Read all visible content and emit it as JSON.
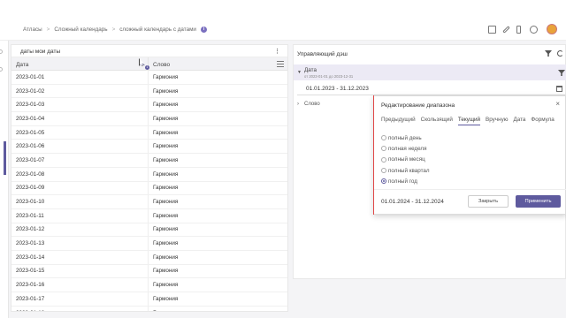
{
  "breadcrumb": [
    "Атласы",
    "Сложный календарь",
    "сложный календарь с датами"
  ],
  "breadcrumb_separator": ">",
  "info_icon": "info-icon",
  "table_panel": {
    "title": "даты мои даты",
    "menu_icon": "⋮",
    "columns": [
      "Дата",
      "Слово"
    ],
    "sort_badge": "1",
    "rows": [
      {
        "date": "2023-01-01",
        "word": "Гармония"
      },
      {
        "date": "2023-01-02",
        "word": "Гармония"
      },
      {
        "date": "2023-01-03",
        "word": "Гармония"
      },
      {
        "date": "2023-01-04",
        "word": "Гармония"
      },
      {
        "date": "2023-01-05",
        "word": "Гармония"
      },
      {
        "date": "2023-01-06",
        "word": "Гармония"
      },
      {
        "date": "2023-01-07",
        "word": "Гармония"
      },
      {
        "date": "2023-01-08",
        "word": "Гармония"
      },
      {
        "date": "2023-01-09",
        "word": "Гармония"
      },
      {
        "date": "2023-01-10",
        "word": "Гармония"
      },
      {
        "date": "2023-01-11",
        "word": "Гармония"
      },
      {
        "date": "2023-01-12",
        "word": "Гармония"
      },
      {
        "date": "2023-01-13",
        "word": "Гармония"
      },
      {
        "date": "2023-01-14",
        "word": "Гармония"
      },
      {
        "date": "2023-01-15",
        "word": "Гармония"
      },
      {
        "date": "2023-01-16",
        "word": "Гармония"
      },
      {
        "date": "2023-01-17",
        "word": "Гармония"
      },
      {
        "date": "2023-01-18",
        "word": "Гармония"
      }
    ]
  },
  "dash_panel": {
    "title": "Управляющий дэш",
    "date_filter": {
      "label": "Дата",
      "sublabel": "от 2023-01-01 до 2023-12-31",
      "value": "01.01.2023 - 31.12.2023"
    },
    "word_filter": {
      "label": "Слово"
    }
  },
  "modal": {
    "title": "Редактирование диапазона",
    "close_icon": "×",
    "tabs": [
      "Предыдущий",
      "Скользящий",
      "Текущий",
      "Вручную",
      "Дата",
      "Формула"
    ],
    "active_tab": "Текущий",
    "options": [
      "полный день",
      "полная неделя",
      "полный месяц",
      "полный квартал",
      "полный год"
    ],
    "selected_option": "полный год",
    "range_text": "01.01.2024 - 31.12.2024",
    "close_button": "Закрыть",
    "apply_button": "Применить"
  },
  "colors": {
    "accent": "#5e5a9e",
    "filter_bg": "#eceaf5",
    "red_marker": "#e04848"
  }
}
